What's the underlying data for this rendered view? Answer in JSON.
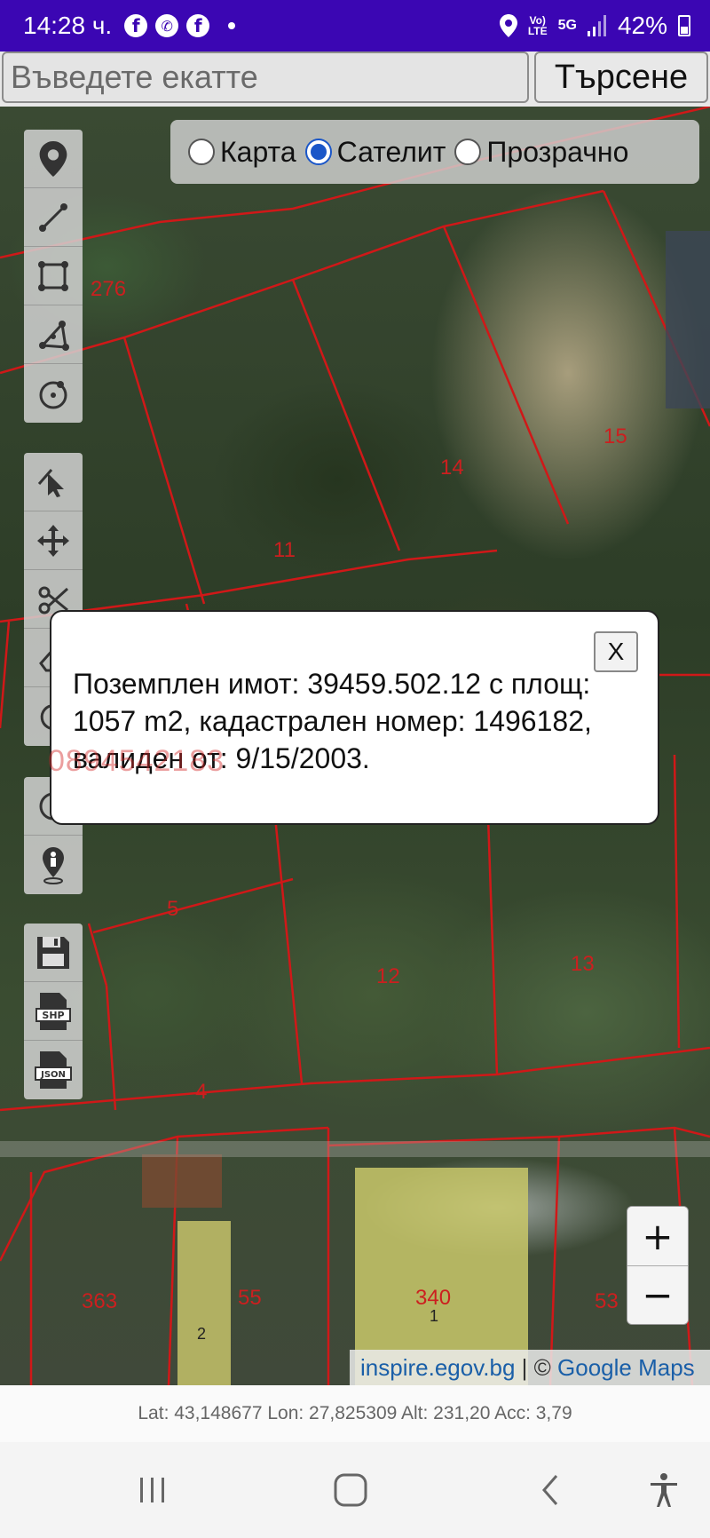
{
  "statusbar": {
    "time": "14:28 ч.",
    "notification_icons": [
      "facebook-icon",
      "viber-icon",
      "facebook-icon"
    ],
    "network_top": "Vo)",
    "network_bottom": "LTE",
    "network_5g": "5G",
    "battery": "42%"
  },
  "search": {
    "placeholder": "Въведете екатте",
    "button_label": "Търсене"
  },
  "layers": {
    "options": [
      {
        "label": "Карта",
        "checked": false
      },
      {
        "label": "Сателит",
        "checked": true
      },
      {
        "label": "Прозрачно",
        "checked": false
      }
    ]
  },
  "toolbar": {
    "group1": [
      "location-pin-icon",
      "line-draw-icon",
      "polygon-square-icon",
      "polygon-triangle-icon",
      "circle-draw-icon"
    ],
    "group2": [
      "select-cursor-icon",
      "move-arrows-icon",
      "scissors-icon",
      "eraser-icon",
      "undo-icon"
    ],
    "group3": [
      "circle-tool-icon",
      "person-location-icon"
    ],
    "group4": [
      "save-icon",
      "shp-file-icon",
      "json-file-icon"
    ],
    "shp_label": "SHP",
    "json_label": "JSON"
  },
  "parcels": [
    "276",
    "15",
    "14",
    "11",
    "5",
    "12",
    "13",
    "4",
    "363",
    "55",
    "340",
    "53",
    "1",
    "2"
  ],
  "popup": {
    "text": "Поземплен имот: 39459.502.12 с площ: 1057 m2, кадастрален номер: 1496182, валиден от: 9/15/2003.",
    "close_label": "X",
    "watermark": "0894542183"
  },
  "zoom": {
    "in_label": "+",
    "out_label": "−"
  },
  "attribution": {
    "source": "inspire.egov.bg",
    "separator": " | © ",
    "provider": "Google Maps"
  },
  "coords": {
    "text": "Lat: 43,148677 Lon: 27,825309 Alt: 231,20 Acc: 3,79"
  },
  "colors": {
    "statusbar": "#3b06b3",
    "parcel_lines": "#d01818",
    "radio_accent": "#1a56c8"
  }
}
